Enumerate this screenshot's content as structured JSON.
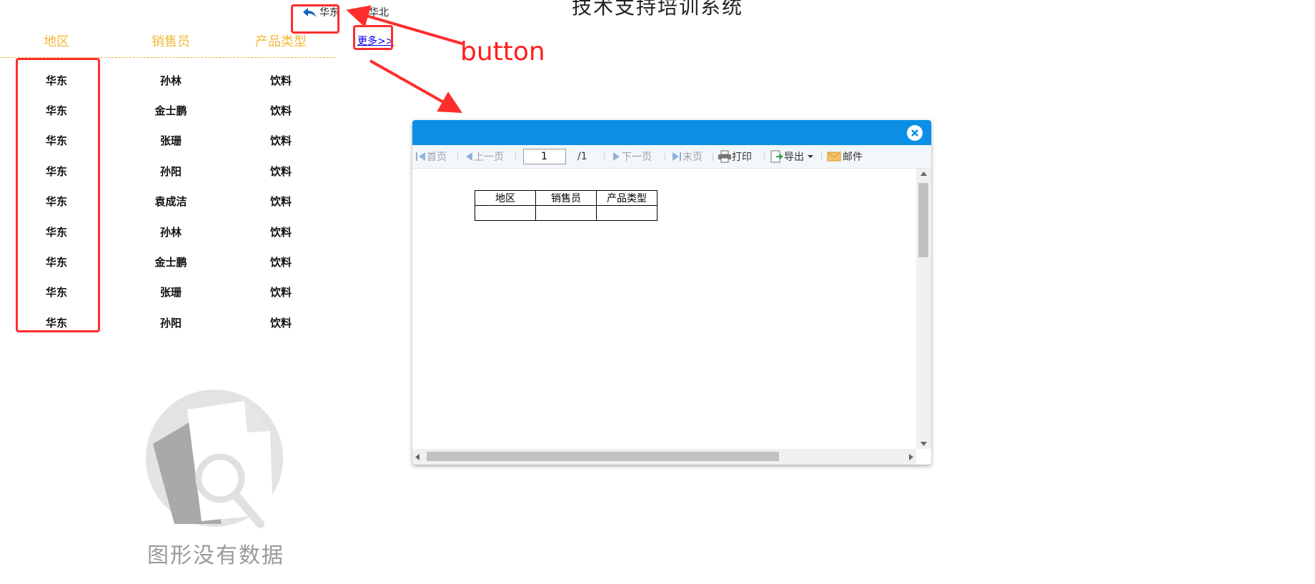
{
  "header": {
    "title": "技术支持培训系统"
  },
  "breadcrumb": {
    "back_label": "华东",
    "next_label": "华北"
  },
  "left_table": {
    "headers": [
      "地区",
      "销售员",
      "产品类型"
    ],
    "rows": [
      [
        "华东",
        "孙林",
        "饮料"
      ],
      [
        "华东",
        "金士鹏",
        "饮料"
      ],
      [
        "华东",
        "张珊",
        "饮料"
      ],
      [
        "华东",
        "孙阳",
        "饮料"
      ],
      [
        "华东",
        "袁成洁",
        "饮料"
      ],
      [
        "华东",
        "孙林",
        "饮料"
      ],
      [
        "华东",
        "金士鹏",
        "饮料"
      ],
      [
        "华东",
        "张珊",
        "饮料"
      ],
      [
        "华东",
        "孙阳",
        "饮料"
      ]
    ]
  },
  "more_link": "更多>>",
  "annotation": {
    "text": "button"
  },
  "chart_placeholder": {
    "text": "图形没有数据"
  },
  "dialog": {
    "toolbar": {
      "first": "首页",
      "prev": "上一页",
      "page_value": "1",
      "total": "/1",
      "next": "下一页",
      "last": "末页",
      "print": "打印",
      "export": "导出",
      "mail": "邮件"
    },
    "report_headers": [
      "地区",
      "销售员",
      "产品类型"
    ]
  },
  "colors": {
    "accent_blue": "#0a8fe5",
    "header_gold": "#f4b83a",
    "annotation_red": "#ff2d2d"
  }
}
